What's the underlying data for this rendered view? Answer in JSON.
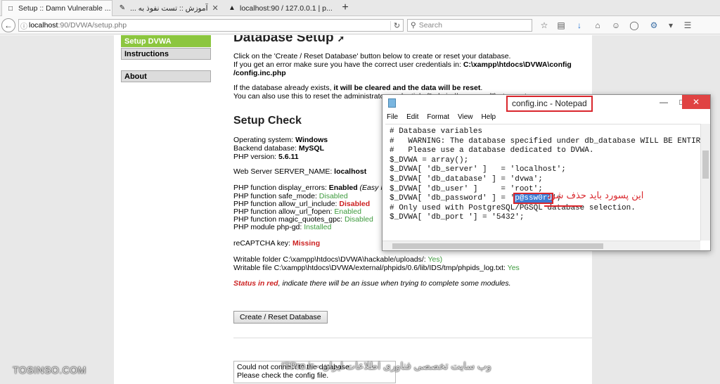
{
  "browser": {
    "tabs": [
      {
        "title": "Setup :: Damn Vulnerable ...",
        "active": true
      },
      {
        "title": "آموزش :: تست نفوذ به ..."
      },
      {
        "title": "localhost:90 / 127.0.0.1 | p..."
      }
    ],
    "url_host": "localhost",
    "url_path": ":90/DVWA/setup.php",
    "search_placeholder": "Search"
  },
  "sidebar": {
    "items": [
      {
        "label": "Setup DVWA",
        "selected": true
      },
      {
        "label": "Instructions"
      },
      {
        "label": "About"
      }
    ]
  },
  "main": {
    "title": "Database Setup",
    "intro_line1": "Click on the 'Create / Reset Database' button below to create or reset your database.",
    "intro_line2_prefix": "If you get an error make sure you have the correct user credentials in: ",
    "intro_line2_bold": "C:\\xampp\\htdocs\\DVWA\\config",
    "intro_line3_bold": "/config.inc.php",
    "exists_prefix": "If the database already exists, ",
    "exists_bold": "it will be cleared and the data will be reset",
    "exists_suffix": ".",
    "reset_text": "You can also use this to reset the administrator credentials (\"admin // password\") at any stage.",
    "setup_check_title": "Setup Check",
    "os_label": "Operating system: ",
    "os_value": "Windows",
    "db_label": "Backend database: ",
    "db_value": "MySQL",
    "php_label": "PHP version: ",
    "php_value": "5.6.11",
    "server_label": "Web Server SERVER_NAME: ",
    "server_value": "localhost",
    "php_display_errors_label": "PHP function display_errors: ",
    "php_display_errors_value": "Enabled",
    "php_display_errors_note": " (Easy Mode!)",
    "php_safe_mode_label": "PHP function safe_mode: ",
    "php_safe_mode_value": "Disabled",
    "php_allow_url_include_label": "PHP function allow_url_include: ",
    "php_allow_url_include_value": "Disabled",
    "php_allow_url_fopen_label": "PHP function allow_url_fopen: ",
    "php_allow_url_fopen_value": "Enabled",
    "php_magic_quotes_label": "PHP function magic_quotes_gpc: ",
    "php_magic_quotes_value": "Disabled",
    "php_pgsql_label": "PHP module php-gd: ",
    "php_pgsql_value": "Installed",
    "recaptcha_label": "reCAPTCHA key: ",
    "recaptcha_value": "Missing",
    "writable_folder_label": "Writable folder C:\\xampp\\htdocs\\DVWA\\hackable/uploads/: ",
    "writable_folder_value": "Yes)",
    "writable_file_label": "Writable file C:\\xampp\\htdocs\\DVWA/external/phpids/0.6/lib/IDS/tmp/phpids_log.txt: ",
    "writable_file_value": "Yes",
    "status_red": "Status in red",
    "status_suffix": ", indicate there will be an issue when trying to complete some modules.",
    "create_button": "Create / Reset Database",
    "error_line1": "Could not connect to the database.",
    "error_line2": "Please check the config file."
  },
  "notepad": {
    "title": "config.inc - Notepad",
    "menu": [
      "File",
      "Edit",
      "Format",
      "View",
      "Help"
    ],
    "lines": [
      "",
      "# Database variables",
      "#   WARNING: The database specified under db_database WILL BE ENTIRELY DE",
      "#   Please use a database dedicated to DVWA.",
      "$_DVWA = array();",
      "$_DVWA[ 'db_server' ]   = 'localhost';",
      "$_DVWA[ 'db_database' ] = 'dvwa';",
      "$_DVWA[ 'db_user' ]     = 'root';"
    ],
    "password_line_prefix": "$_DVWA[ 'db_password' ] = '",
    "password_value": "p@ssw0rd",
    "password_line_suffix": "';",
    "lines_after": [
      "",
      "# Only used with PostgreSQL/PGSQL database selection.",
      "$_DVWA[ 'db_port '] = '5432';"
    ]
  },
  "annotation": {
    "note": "این پسورد باید حذف شود"
  },
  "watermarks": {
    "left": "TOSINSO.COM",
    "center": "وب سایت تخصصی فناوری اطلاعات ایران - ITPro.ir"
  },
  "colors": {
    "accent_green": "#8cc63f",
    "status_red": "#cc2222",
    "highlight_box": "#d9262c"
  }
}
